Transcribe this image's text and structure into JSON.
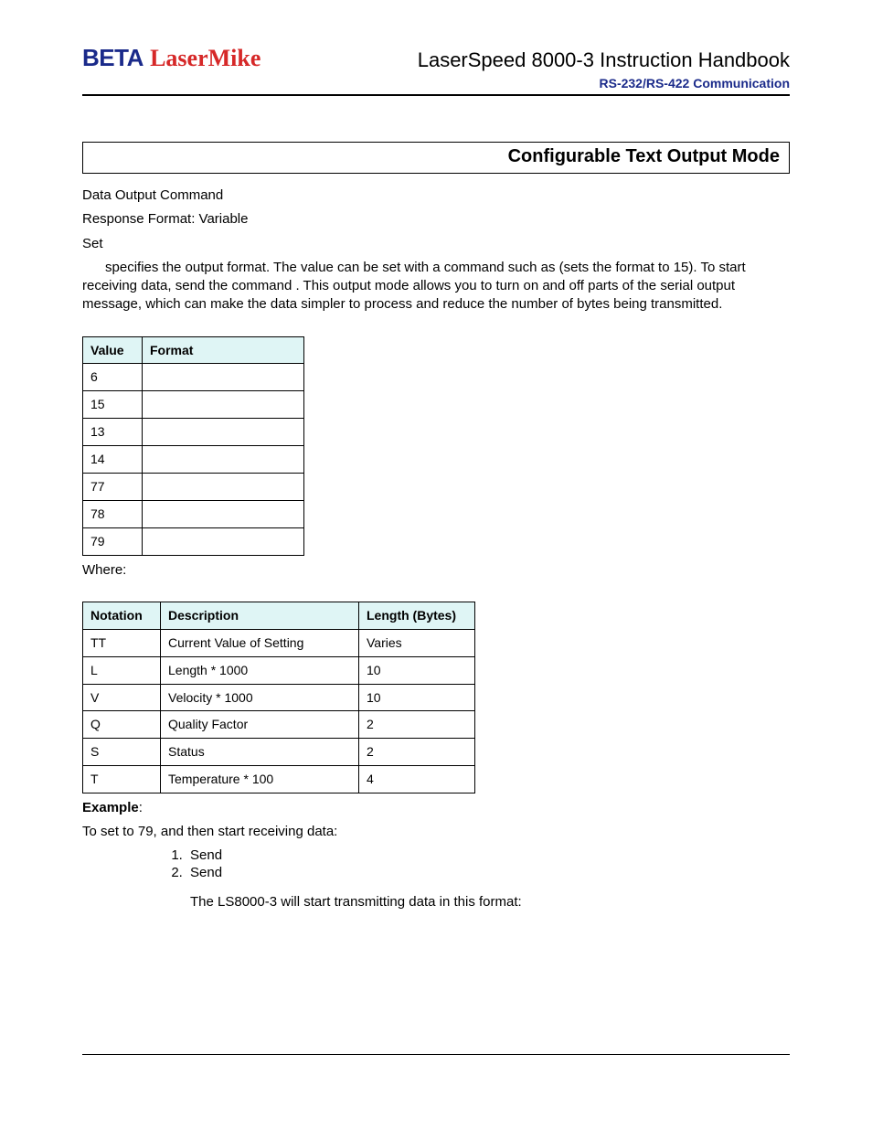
{
  "header": {
    "logo_beta": "BETA",
    "logo_lasermike": "LaserMike",
    "title": "LaserSpeed 8000-3 Instruction Handbook",
    "subtitle": "RS-232/RS-422 Communication"
  },
  "section_heading": "Configurable Text Output Mode",
  "intro": {
    "line1": "Data Output Command",
    "line2": "Response Format: Variable",
    "line3": "Set",
    "para": " specifies the output format.  The value can be set with a command such as (sets the format to 15).  To start receiving data, send the command            .  This output mode allows you to turn on and off parts of the serial output message, which can make the data simpler to process and reduce the number of bytes being transmitted."
  },
  "table1": {
    "headers": [
      "Value",
      "Format"
    ],
    "rows": [
      [
        "6",
        ""
      ],
      [
        "15",
        ""
      ],
      [
        "13",
        ""
      ],
      [
        "14",
        ""
      ],
      [
        "77",
        ""
      ],
      [
        "78",
        ""
      ],
      [
        "79",
        ""
      ]
    ]
  },
  "where_label": "Where:",
  "table2": {
    "headers": [
      "Notation",
      "Description",
      "Length (Bytes)"
    ],
    "rows": [
      [
        "TT",
        "Current Value of         Setting",
        "Varies"
      ],
      [
        "L",
        "Length * 1000",
        "10"
      ],
      [
        "V",
        "Velocity * 1000",
        "10"
      ],
      [
        "Q",
        "Quality Factor",
        "2"
      ],
      [
        "S",
        "Status",
        "2"
      ],
      [
        "T",
        "Temperature * 100",
        "4"
      ]
    ]
  },
  "example": {
    "label": "Example",
    "colon": ":",
    "line": "To set      to 79, and then start receiving data:",
    "steps": [
      "Send",
      "Send"
    ],
    "after": "The LS8000-3 will start transmitting data in this format:"
  }
}
